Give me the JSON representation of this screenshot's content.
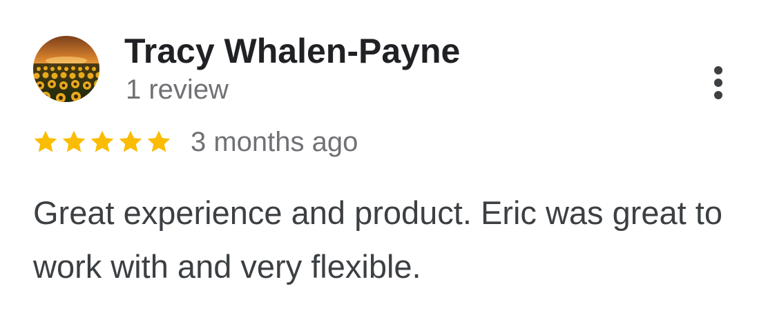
{
  "review": {
    "author_name": "Tracy Whalen-Payne",
    "review_count": "1 review",
    "rating": 5,
    "rating_max": 5,
    "date": "3 months ago",
    "text": "Great experience and product. Eric was great to work with and very flexible.",
    "avatar_icon": "sunflower-field-avatar",
    "more_icon": "more-vert-icon",
    "star_color": "#fbbc04"
  }
}
